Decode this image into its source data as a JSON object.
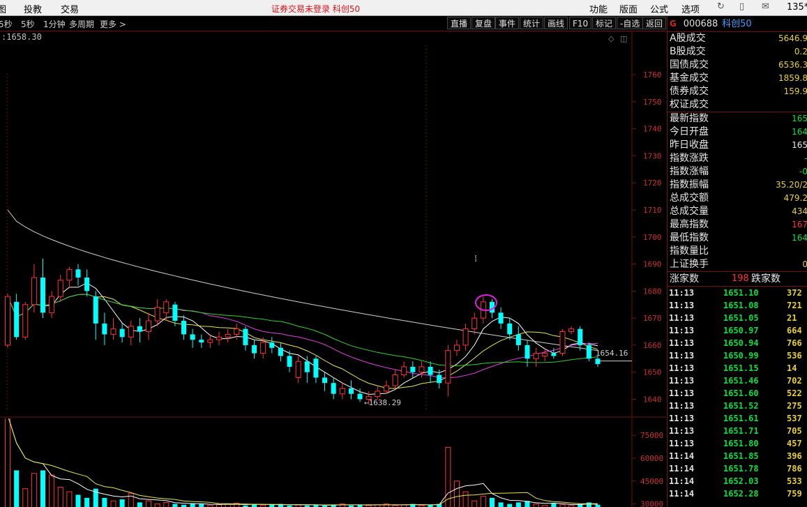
{
  "menubar": {
    "left_items": [
      "图",
      "投教",
      "交易"
    ],
    "notice": "证券交易未登录  科创50",
    "right_items": [
      "功能",
      "版面",
      "公式",
      "选项"
    ],
    "corner": "135*"
  },
  "toolbar": {
    "periods": [
      "5秒",
      "5秒",
      "1分钟",
      "多周期",
      "更多 >"
    ],
    "buttons": [
      "直播",
      "复盘",
      "事件",
      "统计",
      "画线",
      "F10",
      "标记",
      "-自选",
      "返回"
    ]
  },
  "chart_info": {
    "header": ":1658.30",
    "last_label": "1654.16",
    "low_label": "←1638.29"
  },
  "panel": {
    "flag": "G",
    "code": "000688",
    "name": "科创50",
    "group1": [
      {
        "label": "A股成交",
        "value": "5646.9",
        "color": "#e8d030"
      },
      {
        "label": "B股成交",
        "value": "0.2",
        "color": "#e8d030"
      },
      {
        "label": "国债成交",
        "value": "6536.3",
        "color": "#e8d030"
      },
      {
        "label": "基金成交",
        "value": "1859.8",
        "color": "#e8d030"
      },
      {
        "label": "债券成交",
        "value": "159.9",
        "color": "#e8d030"
      },
      {
        "label": "权证成交",
        "value": "",
        "color": "#e8d030"
      }
    ],
    "group2": [
      {
        "label": "最新指数",
        "value": "165",
        "color": "#00e040"
      },
      {
        "label": "今日开盘",
        "value": "164",
        "color": "#00e040"
      },
      {
        "label": "昨日收盘",
        "value": "165",
        "color": "#e8e8e8"
      },
      {
        "label": "指数涨跌",
        "value": "-",
        "color": "#00e040"
      },
      {
        "label": "指数涨幅",
        "value": "-0",
        "color": "#00e040"
      },
      {
        "label": "指数振幅",
        "value": "35.20/2",
        "color": "#e8d030"
      },
      {
        "label": "总成交额",
        "value": "479.2",
        "color": "#e8d030"
      },
      {
        "label": "总成交量",
        "value": "434",
        "color": "#e8d030"
      },
      {
        "label": "最高指数",
        "value": "167",
        "color": "#ff3333"
      },
      {
        "label": "最低指数",
        "value": "164",
        "color": "#00e040"
      },
      {
        "label": "指数量比",
        "value": "",
        "color": "#e8d030"
      },
      {
        "label": "上证换手",
        "value": "0",
        "color": "#e8d030"
      }
    ],
    "updown": {
      "up_label": "涨家数",
      "up_count": "198",
      "down_label": "跌家数"
    },
    "ticks": [
      {
        "time": "11:13",
        "price": "1651.10",
        "vol": "372"
      },
      {
        "time": "11:13",
        "price": "1651.08",
        "vol": "721"
      },
      {
        "time": "11:13",
        "price": "1651.05",
        "vol": "21"
      },
      {
        "time": "11:13",
        "price": "1650.97",
        "vol": "664"
      },
      {
        "time": "11:13",
        "price": "1650.94",
        "vol": "766"
      },
      {
        "time": "11:13",
        "price": "1650.99",
        "vol": "536"
      },
      {
        "time": "11:13",
        "price": "1651.15",
        "vol": "14"
      },
      {
        "time": "11:13",
        "price": "1651.46",
        "vol": "702"
      },
      {
        "time": "11:13",
        "price": "1651.60",
        "vol": "522"
      },
      {
        "time": "11:13",
        "price": "1651.52",
        "vol": "275"
      },
      {
        "time": "11:13",
        "price": "1651.61",
        "vol": "537"
      },
      {
        "time": "11:13",
        "price": "1651.71",
        "vol": "705"
      },
      {
        "time": "11:13",
        "price": "1651.80",
        "vol": "457"
      },
      {
        "time": "11:14",
        "price": "1651.85",
        "vol": "396"
      },
      {
        "time": "11:14",
        "price": "1651.78",
        "vol": "786"
      },
      {
        "time": "11:14",
        "price": "1652.03",
        "vol": "533"
      },
      {
        "time": "11:14",
        "price": "1652.28",
        "vol": "759"
      }
    ]
  },
  "colors": {
    "up": "#ff3333",
    "down": "#00ffff",
    "ma5": "#ffffff",
    "ma10": "#e8e850",
    "ma20": "#e040e0",
    "ma30": "#30d030",
    "ma60": "#d0d0d0",
    "grid": "#6e1414"
  },
  "chart_data": {
    "type": "candlestick",
    "y_ticks": [
      1760,
      1750,
      1740,
      1730,
      1720,
      1710,
      1700,
      1690,
      1680,
      1670,
      1660,
      1650,
      1640
    ],
    "ylim": [
      1636,
      1776
    ],
    "last_price": 1654.16,
    "low_marker": 1638.29,
    "candles": [
      [
        1660,
        1678,
        1679,
        1659
      ],
      [
        1676,
        1663,
        1679,
        1662
      ],
      [
        1663,
        1675,
        1676,
        1662
      ],
      [
        1675,
        1685,
        1690,
        1672
      ],
      [
        1685,
        1672,
        1692,
        1670
      ],
      [
        1672,
        1678,
        1680,
        1670
      ],
      [
        1678,
        1684,
        1686,
        1676
      ],
      [
        1684,
        1688,
        1689,
        1681
      ],
      [
        1688,
        1685,
        1690,
        1682
      ],
      [
        1685,
        1680,
        1688,
        1678
      ],
      [
        1678,
        1668,
        1680,
        1662
      ],
      [
        1668,
        1664,
        1672,
        1660
      ],
      [
        1664,
        1666,
        1670,
        1662
      ],
      [
        1666,
        1663,
        1668,
        1661
      ],
      [
        1663,
        1667,
        1669,
        1660
      ],
      [
        1667,
        1665,
        1670,
        1661
      ],
      [
        1665,
        1669,
        1672,
        1662
      ],
      [
        1669,
        1674,
        1677,
        1667
      ],
      [
        1672,
        1676,
        1677,
        1669
      ],
      [
        1675,
        1669,
        1676,
        1667
      ],
      [
        1669,
        1664,
        1671,
        1662
      ],
      [
        1664,
        1662,
        1666,
        1659
      ],
      [
        1662,
        1661,
        1664,
        1659
      ],
      [
        1661,
        1662,
        1664,
        1659
      ],
      [
        1662,
        1663,
        1665,
        1660
      ],
      [
        1663,
        1664,
        1666,
        1661
      ],
      [
        1664,
        1666,
        1668,
        1662
      ],
      [
        1666,
        1660,
        1667,
        1658
      ],
      [
        1660,
        1657,
        1662,
        1655
      ],
      [
        1657,
        1661,
        1663,
        1655
      ],
      [
        1661,
        1659,
        1663,
        1657
      ],
      [
        1659,
        1656,
        1661,
        1654
      ],
      [
        1656,
        1652,
        1658,
        1650
      ],
      [
        1648,
        1654,
        1656,
        1646
      ],
      [
        1654,
        1650,
        1656,
        1646
      ],
      [
        1655,
        1648,
        1656,
        1646
      ],
      [
        1648,
        1646,
        1650,
        1643
      ],
      [
        1646,
        1642,
        1648,
        1640
      ],
      [
        1642,
        1644,
        1646,
        1640
      ],
      [
        1644,
        1642,
        1647,
        1640
      ],
      [
        1642,
        1640,
        1644,
        1639
      ],
      [
        1640,
        1641,
        1643,
        1638
      ],
      [
        1641,
        1643,
        1645,
        1640
      ],
      [
        1643,
        1645,
        1647,
        1642
      ],
      [
        1645,
        1649,
        1651,
        1644
      ],
      [
        1649,
        1652,
        1654,
        1648
      ],
      [
        1652,
        1650,
        1654,
        1648
      ],
      [
        1650,
        1652,
        1654,
        1648
      ],
      [
        1652,
        1649,
        1654,
        1646
      ],
      [
        1649,
        1646,
        1651,
        1644
      ],
      [
        1646,
        1658,
        1660,
        1641
      ],
      [
        1658,
        1660,
        1662,
        1656
      ],
      [
        1660,
        1666,
        1668,
        1658
      ],
      [
        1666,
        1670,
        1672,
        1664
      ],
      [
        1670,
        1676,
        1678,
        1668
      ],
      [
        1676,
        1672,
        1677,
        1670
      ],
      [
        1672,
        1668,
        1674,
        1666
      ],
      [
        1668,
        1664,
        1670,
        1662
      ],
      [
        1664,
        1660,
        1667,
        1658
      ],
      [
        1660,
        1655,
        1662,
        1652
      ],
      [
        1655,
        1657,
        1659,
        1652
      ],
      [
        1656,
        1657,
        1659,
        1654
      ],
      [
        1657,
        1656,
        1659,
        1655
      ],
      [
        1657,
        1665,
        1666,
        1656
      ],
      [
        1665,
        1666,
        1667,
        1664
      ],
      [
        1666,
        1660,
        1667,
        1658
      ],
      [
        1660,
        1655,
        1661,
        1654
      ],
      [
        1655,
        1653,
        1656,
        1652
      ]
    ],
    "volume_ticks": [
      75000,
      60000,
      45000,
      30000
    ],
    "volume_ylim": [
      28000,
      86000
    ],
    "volumes": [
      88000,
      52000,
      40000,
      50000,
      52000,
      49000,
      41000,
      38000,
      36000,
      34000,
      40000,
      34000,
      32000,
      33000,
      37000,
      31000,
      32000,
      30000,
      31000,
      30000,
      29500,
      30500,
      30000,
      29000,
      29500,
      30000,
      30500,
      29000,
      30000,
      29000,
      29500,
      30000,
      29000,
      29500,
      29000,
      29500,
      29000,
      29500,
      30000,
      29000,
      29500,
      29000,
      29500,
      30000,
      29000,
      29500,
      30000,
      29000,
      29500,
      30000,
      67000,
      45000,
      38000,
      32000,
      35000,
      34000,
      31000,
      30000,
      31000,
      32000,
      30000,
      29000,
      30500,
      29500,
      29000,
      30000,
      31000,
      29500
    ]
  }
}
